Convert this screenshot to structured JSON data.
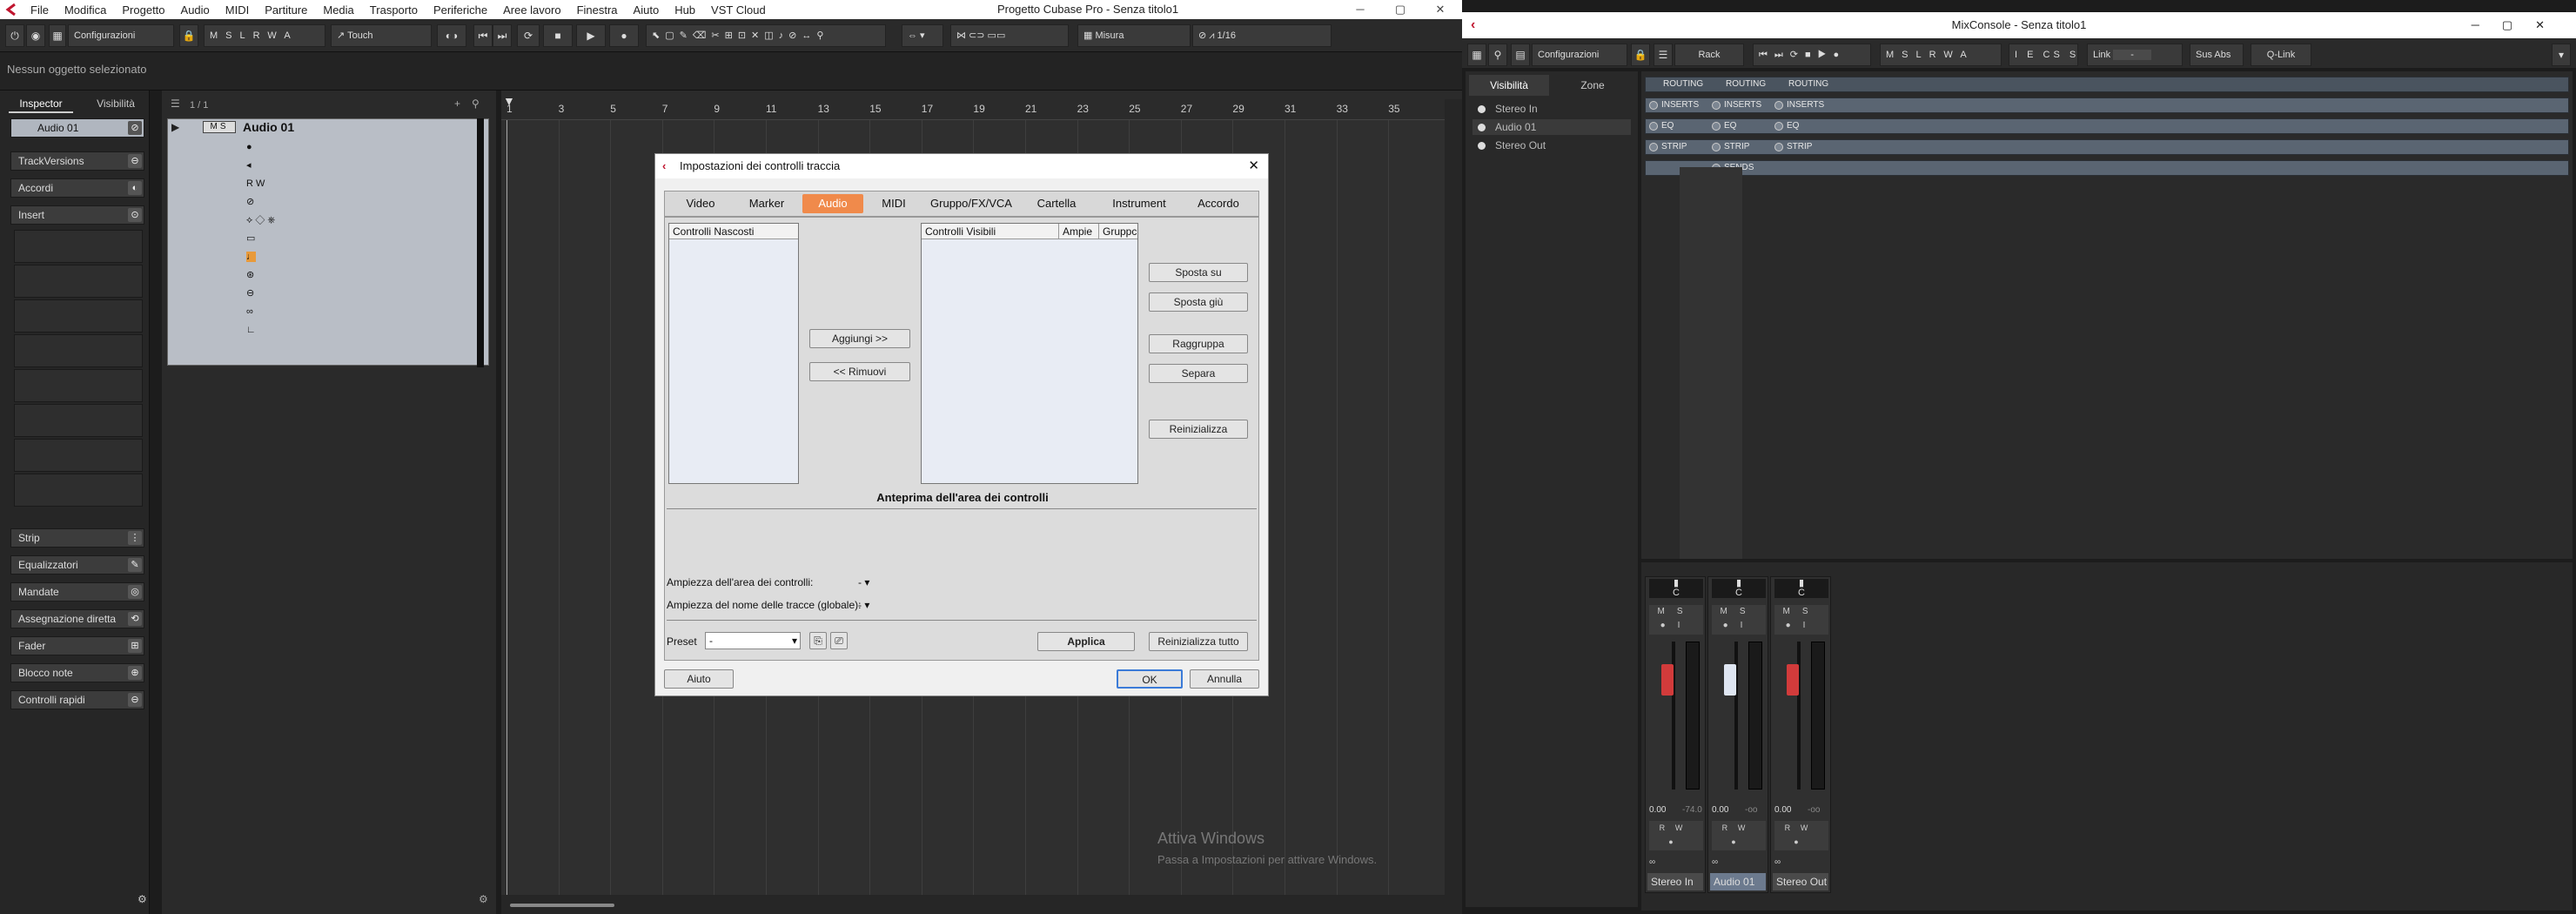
{
  "menubar": {
    "items": [
      "File",
      "Modifica",
      "Progetto",
      "Audio",
      "MIDI",
      "Partiture",
      "Media",
      "Trasporto",
      "Periferiche",
      "Aree lavoro",
      "Finestra",
      "Aiuto",
      "Hub",
      "VST Cloud"
    ]
  },
  "main_window": {
    "title": "Progetto Cubase Pro - Senza titolo1"
  },
  "toolbar": {
    "config_label": "Configurazioni",
    "msrw": [
      "M",
      "S",
      "L",
      "R",
      "W",
      "A"
    ],
    "automation_mode": "Touch",
    "measure_label": "Misura",
    "quantize": "1/16"
  },
  "status": {
    "text": "Nessun oggetto selezionato"
  },
  "inspector": {
    "tab_inspector": "Inspector",
    "tab_visibility": "Visibilità",
    "track_name": "Audio 01",
    "sections_top": [
      "TrackVersions",
      "Accordi",
      "Insert"
    ],
    "sections_bottom": [
      "Strip",
      "Equalizzatori",
      "Mandate",
      "Assegnazione diretta",
      "Fader",
      "Blocco note",
      "Controlli rapidi"
    ]
  },
  "tracklist": {
    "counter": "1 / 1",
    "track_name": "Audio 01",
    "buttons": [
      "M",
      "S"
    ]
  },
  "ruler": {
    "numbers": [
      "1",
      "3",
      "5",
      "7",
      "9",
      "11",
      "13",
      "15",
      "17",
      "19",
      "21",
      "23",
      "25",
      "27",
      "29",
      "31",
      "33",
      "35"
    ]
  },
  "watermark": {
    "line1": "Attiva Windows",
    "line2": "Passa a Impostazioni per attivare Windows."
  },
  "dialog": {
    "title": "Impostazioni dei controlli traccia",
    "tabs": [
      "Video",
      "Marker",
      "Audio",
      "MIDI",
      "Gruppo/FX/VCA",
      "Cartella",
      "Instrument",
      "Accordo"
    ],
    "active_tab": "Audio",
    "hidden_header": "Controlli Nascosti",
    "visible_headers": [
      "Controlli Visibili",
      "Ampie",
      "Gruppc"
    ],
    "add_button": "Aggiungi >>",
    "remove_button": "<< Rimuovi",
    "move_up": "Sposta su",
    "move_down": "Sposta giù",
    "group": "Raggruppa",
    "separate": "Separa",
    "reset": "Reinizializza",
    "preview_title": "Anteprima dell'area dei controlli",
    "width_label": "Ampiezza dell'area dei controlli:",
    "name_width_label": "Ampiezza del nome delle tracce (globale):",
    "width_value": "-",
    "preset_label": "Preset",
    "preset_value": "-",
    "apply": "Applica",
    "reset_all": "Reinizializza tutto",
    "help": "Aiuto",
    "ok": "OK",
    "cancel": "Annulla"
  },
  "mixconsole": {
    "title": "MixConsole - Senza titolo1",
    "config_label": "Configurazioni",
    "rack_label": "Rack",
    "link_label": "Link",
    "toolbar_labels": [
      "Sus",
      "Abs",
      "Q-Link"
    ],
    "tab_visibility": "Visibilità",
    "tab_zones": "Zone",
    "channels_list": [
      "Stereo In",
      "Audio 01",
      "Stereo Out"
    ],
    "rack_rows": {
      "routing": [
        "ROUTING",
        "ROUTING",
        "ROUTING"
      ],
      "inserts": [
        "INSERTS",
        "INSERTS",
        "INSERTS"
      ],
      "eq": [
        "EQ",
        "EQ",
        "EQ"
      ],
      "strip": [
        "STRIP",
        "STRIP",
        "STRIP"
      ],
      "sends": [
        "",
        "SENDS",
        ""
      ]
    },
    "strips": [
      {
        "name": "Stereo In",
        "pan": "C",
        "level": "0.00",
        "peak": "-74.0",
        "fader_color": "#d23b3b"
      },
      {
        "name": "Audio 01",
        "pan": "C",
        "level": "0.00",
        "peak": "-oo",
        "fader_color": "#dfe6f2"
      },
      {
        "name": "Stereo Out",
        "pan": "C",
        "level": "0.00",
        "peak": "-oo",
        "fader_color": "#d23b3b"
      }
    ]
  }
}
